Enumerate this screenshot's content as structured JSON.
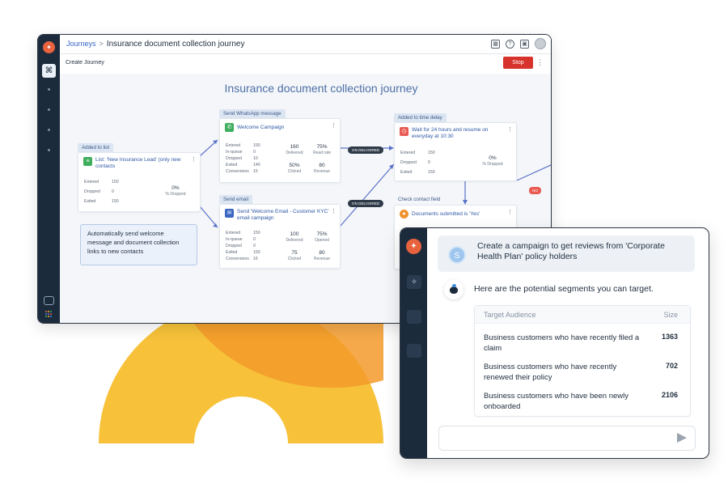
{
  "journey": {
    "breadcrumb_root": "Journeys",
    "breadcrumb_sep": ">",
    "breadcrumb_current": "Insurance document collection journey",
    "subtitle": "Create Journey",
    "stop_label": "Stop",
    "canvas_title": "Insurance document collection journey",
    "on_delivered": "ON DELIVERED",
    "no_badge": "NO",
    "note": "Automatically send welcome message and document collection links to new contacts",
    "list_node": {
      "stage": "Added to list",
      "name": "List: 'New Insurance Lead' (only new contacts",
      "stats": [
        {
          "k": "Entered",
          "v": "150"
        },
        {
          "k": "Dropped",
          "v": "0"
        },
        {
          "k": "Exited",
          "v": "150"
        }
      ],
      "pct": "0%",
      "pct_label": "% Dropped"
    },
    "whatsapp_node": {
      "stage": "Send WhatsApp message",
      "name": "Welcome Campaign",
      "stats": [
        {
          "k": "Entered",
          "v": "150"
        },
        {
          "k": "In-queue",
          "v": "0"
        },
        {
          "k": "Dropped",
          "v": "10"
        },
        {
          "k": "Exited",
          "v": "140"
        },
        {
          "k": "Conversions",
          "v": "15"
        }
      ],
      "metrics": [
        {
          "v": "160",
          "l": "Delivered"
        },
        {
          "v": "75%",
          "l": "Read rate"
        },
        {
          "v": "50%",
          "l": "Clicked"
        },
        {
          "v": "80",
          "l": "Revenue"
        }
      ]
    },
    "email_node": {
      "stage": "Send email",
      "name": "Send 'Welcome Email - Customer KYC' email campaign",
      "stats": [
        {
          "k": "Entered",
          "v": "150"
        },
        {
          "k": "In-queue",
          "v": "0"
        },
        {
          "k": "Dropped",
          "v": "0"
        },
        {
          "k": "Exited",
          "v": "150"
        },
        {
          "k": "Conversions",
          "v": "16"
        }
      ],
      "metrics": [
        {
          "v": "100",
          "l": "Delivered"
        },
        {
          "v": "75%",
          "l": "Opened"
        },
        {
          "v": "75",
          "l": "Clicked"
        },
        {
          "v": "80",
          "l": "Revenue"
        }
      ]
    },
    "delay_node": {
      "stage": "Added to time delay",
      "name": "Wait for 24 hours and resume on everyday at 10:30",
      "stats": [
        {
          "k": "Entered",
          "v": "150"
        },
        {
          "k": "Dropped",
          "v": "0"
        },
        {
          "k": "Exited",
          "v": "150"
        }
      ],
      "pct": "0%",
      "pct_label": "% Dropped"
    },
    "check_node": {
      "stage": "Check contact field",
      "name": "Documents submitted is 'Yes'"
    }
  },
  "chat": {
    "user_initial": "S",
    "prompt": "Create a campaign to get reviews from 'Corporate Health Plan' policy holders",
    "reply": "Here are the potential segments you can target.",
    "table": {
      "headers": [
        "Target Audience",
        "Size"
      ],
      "rows": [
        {
          "audience": "Business customers who have recently filed a claim",
          "size": "1363"
        },
        {
          "audience": "Business customers who have recently renewed their policy",
          "size": "702"
        },
        {
          "audience": "Business customers who have been newly onboarded",
          "size": "2106"
        }
      ]
    },
    "input_placeholder": ""
  },
  "colors": {
    "brand": "#e8623e",
    "rail": "#1c2b3c",
    "stop": "#d7322c",
    "link": "#3a67c4",
    "whatsapp": "#3fae5c",
    "email": "#3a67c4",
    "delay": "#e85a52",
    "check": "#f0922e",
    "deco_yellow": "#f7c23a",
    "deco_orange": "#f39a2a"
  },
  "icons": {
    "logo": "megaphone-icon",
    "journey": "flow-icon",
    "chat_rail": "chat-icon",
    "apps": "grid-icon",
    "calendar": "calendar-icon",
    "help": "help-icon",
    "apps_top": "apps-icon",
    "send": "send-icon"
  }
}
